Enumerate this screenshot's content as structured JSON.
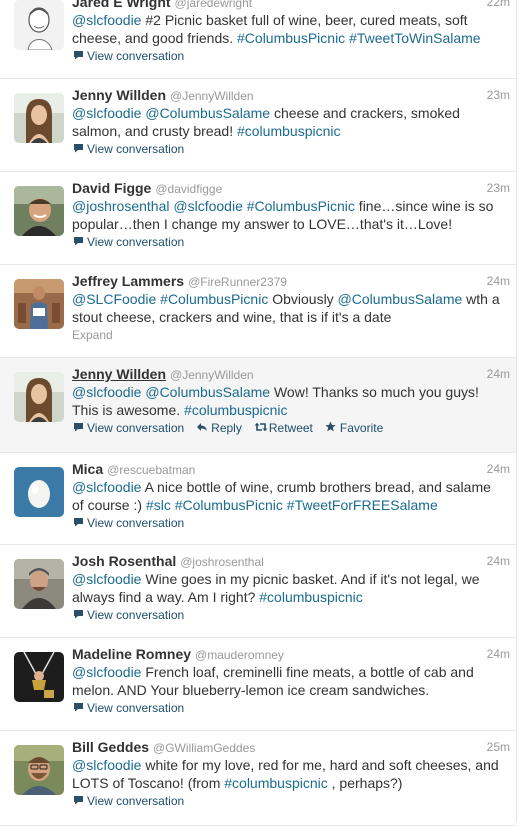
{
  "tweets": [
    {
      "name": "Jared E Wright",
      "handle": "@jaredewright",
      "time": "22m",
      "avatar": "sketch",
      "text": [
        {
          "t": "@slcfoodie"
        },
        {
          "t": " #2 Picnic basket full of wine, beer, cured meats, soft cheese, and good friends. "
        },
        {
          "t": "#ColumbusPicnic"
        },
        {
          "t": " "
        },
        {
          "t": "#TweetToWinSalame"
        }
      ],
      "actions": [
        "View conversation"
      ]
    },
    {
      "name": "Jenny Willden",
      "handle": "@JennyWillden",
      "time": "23m",
      "avatar": "woman",
      "text": [
        {
          "t": "@slcfoodie"
        },
        {
          "t": " "
        },
        {
          "t": "@ColumbusSalame"
        },
        {
          "t": " cheese and crackers, smoked salmon, and crusty bread! "
        },
        {
          "t": "#columbuspicnic"
        }
      ],
      "actions": [
        "View conversation"
      ]
    },
    {
      "name": "David Figge",
      "handle": "@davidfigge",
      "time": "23m",
      "avatar": "man1",
      "text": [
        {
          "t": "@joshrosenthal"
        },
        {
          "t": " "
        },
        {
          "t": "@slcfoodie"
        },
        {
          "t": " "
        },
        {
          "t": "#ColumbusPicnic"
        },
        {
          "t": " fine…since wine is so popular…then I change my answer to LOVE…that's it…Love!"
        }
      ],
      "actions": [
        "View conversation"
      ]
    },
    {
      "name": "Jeffrey Lammers",
      "handle": "@FireRunner2379",
      "time": "24m",
      "avatar": "runner",
      "text": [
        {
          "t": "@SLCFoodie"
        },
        {
          "t": " "
        },
        {
          "t": "#ColumbusPicnic"
        },
        {
          "t": " Obviously "
        },
        {
          "t": "@ColumbusSalame"
        },
        {
          "t": " wth a stout cheese, crackers and wine, that is if it's a date"
        }
      ],
      "expand": "Expand"
    },
    {
      "name": "Jenny Willden",
      "handle": "@JennyWillden",
      "time": "24m",
      "avatar": "woman",
      "highlight": true,
      "text": [
        {
          "t": "@slcfoodie"
        },
        {
          "t": " "
        },
        {
          "t": "@ColumbusSalame"
        },
        {
          "t": " Wow! Thanks so much you guys! This is awesome. "
        },
        {
          "t": "#columbuspicnic"
        }
      ],
      "actions": [
        "View conversation",
        "Reply",
        "Retweet",
        "Favorite"
      ]
    },
    {
      "name": "Mica",
      "handle": "@rescuebatman",
      "time": "24m",
      "avatar": "egg",
      "text": [
        {
          "t": "@slcfoodie"
        },
        {
          "t": " A nice bottle of wine, crumb brothers bread, and salame of course :) "
        },
        {
          "t": "#slc"
        },
        {
          "t": " "
        },
        {
          "t": "#ColumbusPicnic"
        },
        {
          "t": " "
        },
        {
          "t": "#TweetForFREESalame"
        }
      ],
      "actions": [
        "View conversation"
      ]
    },
    {
      "name": "Josh Rosenthal",
      "handle": "@joshrosenthal",
      "time": "24m",
      "avatar": "man2",
      "text": [
        {
          "t": "@slcfoodie"
        },
        {
          "t": " Wine goes in my picnic basket. And if it's not legal, we always find a way. Am I right? "
        },
        {
          "t": "#columbuspicnic"
        }
      ],
      "actions": [
        "View conversation"
      ]
    },
    {
      "name": "Madeline Romney",
      "handle": "@mauderomney",
      "time": "24m",
      "avatar": "swing",
      "text": [
        {
          "t": "@slcfoodie"
        },
        {
          "t": " French loaf, creminelli fine meats, a bottle of cab and melon. AND Your blueberry-lemon ice cream sandwiches."
        }
      ],
      "actions": [
        "View conversation"
      ]
    },
    {
      "name": "Bill Geddes",
      "handle": "@GWilliamGeddes",
      "time": "25m",
      "avatar": "man3",
      "text": [
        {
          "t": "@slcfoodie"
        },
        {
          "t": " white for my love, red for me, hard and soft cheeses, and LOTS of Toscano! (from "
        },
        {
          "t": "#columbuspicnic"
        },
        {
          "t": " , perhaps?)"
        }
      ],
      "actions": [
        "View conversation"
      ]
    }
  ],
  "colors": {
    "link": "#1b6b8f",
    "muted": "#999999",
    "text": "#333333",
    "highlight_bg": "#f5f5f5"
  },
  "icons": {
    "View conversation": "speech-bubble-icon",
    "Reply": "reply-arrow-icon",
    "Retweet": "retweet-icon",
    "Favorite": "star-icon"
  }
}
